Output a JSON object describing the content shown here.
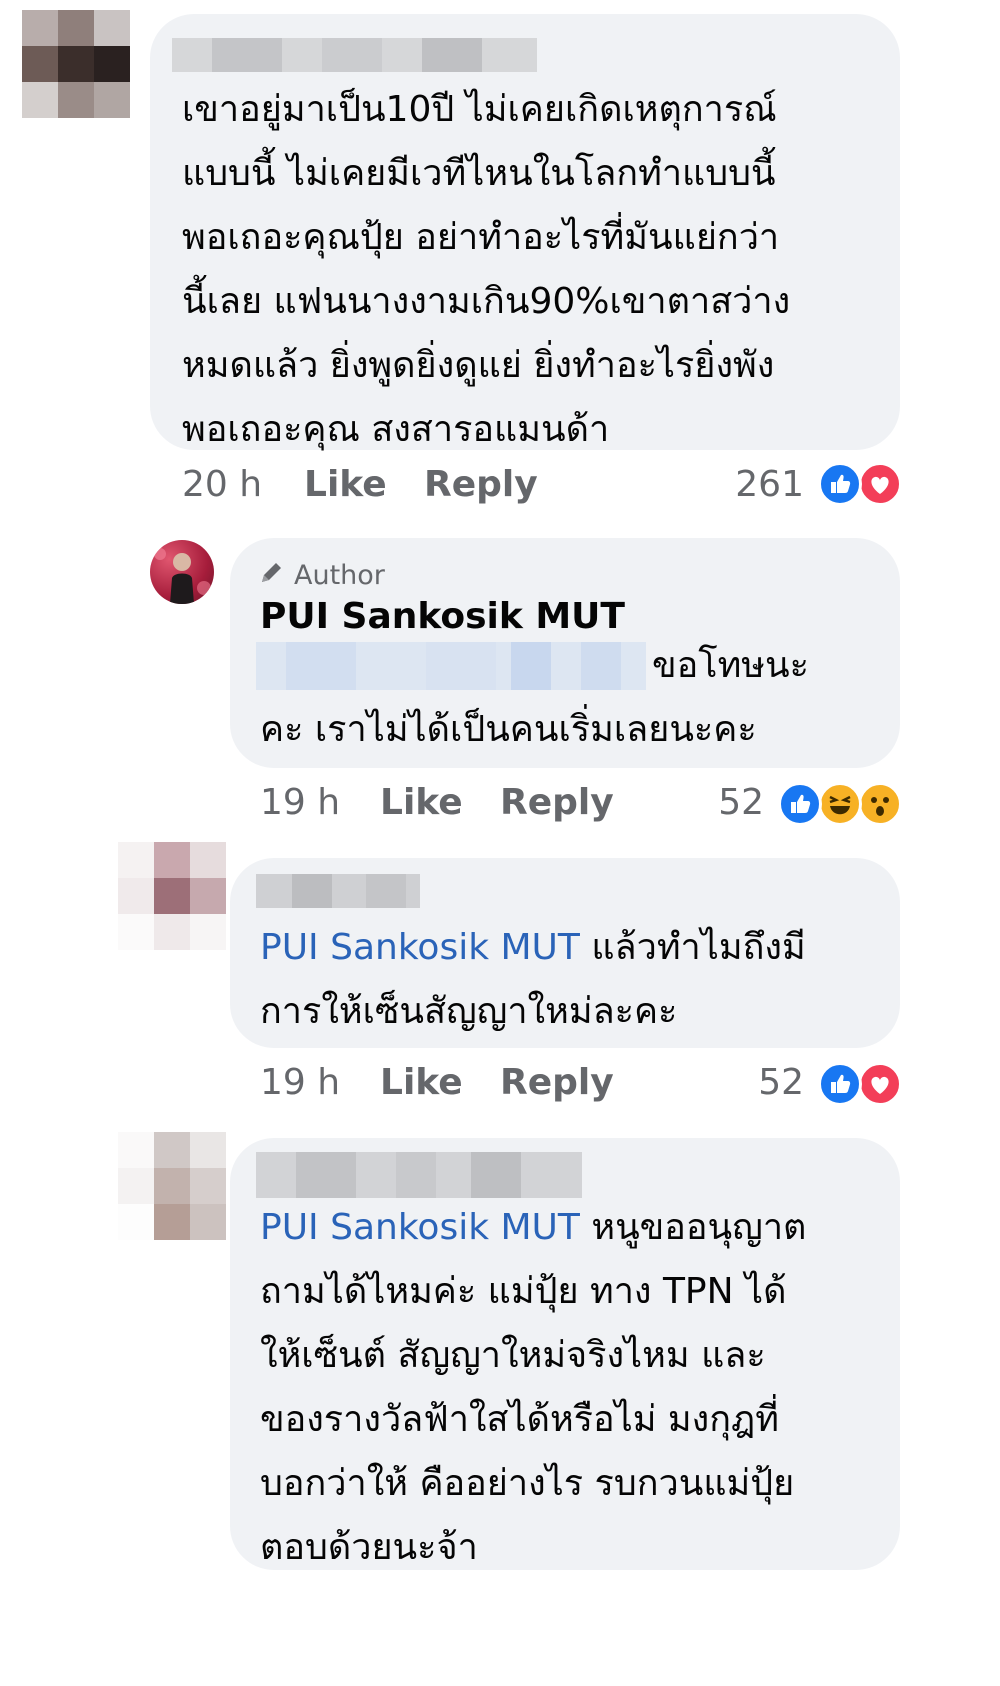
{
  "colors": {
    "bubble": "#f0f2f5",
    "mention": "#2a63b8",
    "meta": "#65676b",
    "like": "#1877f2",
    "love": "#f33e58",
    "haha": "#f7b125"
  },
  "comments": [
    {
      "lines": [
        "เขาอยู่มาเป็น10ปี ไม่เคยเกิดเหตุการณ์",
        "แบบนี้ ไม่เคยมีเวทีไหนในโลกทำแบบนี้",
        "พอเถอะคุณปุ้ย อย่าทำอะไรที่มันแย่กว่า",
        "นี้เลย แฟนนางงามเกิน90%เขาตาสว่าง",
        "หมดแล้ว ยิ่งพูดยิ่งดูแย่ ยิ่งทำอะไรยิ่งพัง",
        "พอเถอะคุณ สงสารอแมนด้า"
      ],
      "time": "20 h",
      "like_label": "Like",
      "reply_label": "Reply",
      "reaction_count": "261",
      "reactions": [
        "like-icon",
        "love-icon"
      ]
    },
    {
      "badge": "Author",
      "name": "PUI Sankosik MUT",
      "lines": [
        "ขอโทษนะ",
        "คะ เราไม่ได้เป็นคนเริ่มเลยนะคะ"
      ],
      "time": "19 h",
      "like_label": "Like",
      "reply_label": "Reply",
      "reaction_count": "52",
      "reactions": [
        "like-icon",
        "haha-icon",
        "wow-icon"
      ]
    },
    {
      "mention": "PUI Sankosik MUT",
      "lines": [
        "แล้วทำไมถึงมี",
        "การให้เซ็นสัญญาใหม่ละคะ"
      ],
      "time": "19 h",
      "like_label": "Like",
      "reply_label": "Reply",
      "reaction_count": "52",
      "reactions": [
        "like-icon",
        "love-icon"
      ]
    },
    {
      "mention": "PUI Sankosik MUT",
      "lines": [
        "หนูขออนุญาต",
        "ถามได้ไหมค่ะ  แม่ปุ้ย  ทาง TPN ได้",
        "ให้เซ็นต์ สัญญาใหม่จริงไหม  และ",
        "ของรางวัลฟ้าใสได้หรือไม่   มงกุฎที่",
        "บอกว่าให้ คืออย่างไร  รบกวนแม่ปุ้ย",
        "ตอบด้วยนะจ้า"
      ]
    }
  ]
}
